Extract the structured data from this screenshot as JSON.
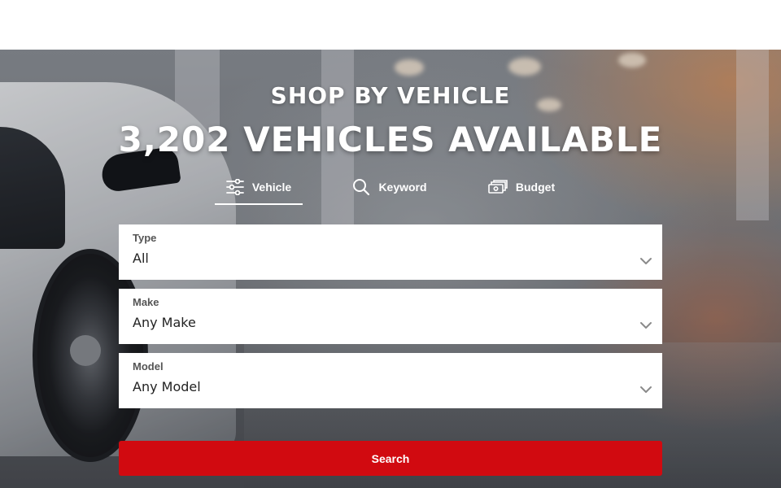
{
  "hero": {
    "eyebrow": "SHOP BY VEHICLE",
    "headline": "3,202 VEHICLES AVAILABLE"
  },
  "tabs": [
    {
      "label": "Vehicle",
      "icon": "sliders-icon",
      "active": true
    },
    {
      "label": "Keyword",
      "icon": "search-icon",
      "active": false
    },
    {
      "label": "Budget",
      "icon": "cash-icon",
      "active": false
    }
  ],
  "filters": {
    "type": {
      "label": "Type",
      "value": "All"
    },
    "make": {
      "label": "Make",
      "value": "Any Make"
    },
    "model": {
      "label": "Model",
      "value": "Any Model"
    }
  },
  "search_button": {
    "label": "Search"
  },
  "colors": {
    "accent": "#d10a10",
    "field_bg": "#ffffff",
    "label_text": "#555555"
  }
}
